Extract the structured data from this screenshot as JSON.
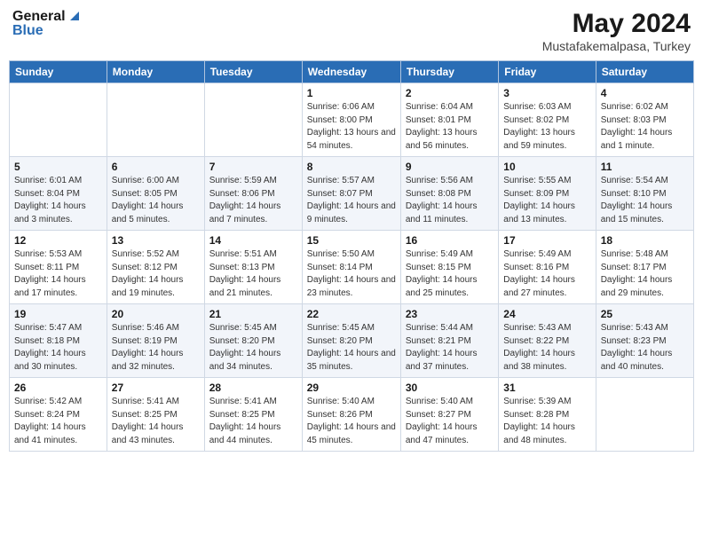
{
  "header": {
    "logo_general": "General",
    "logo_blue": "Blue",
    "month": "May 2024",
    "location": "Mustafakemalpasa, Turkey"
  },
  "days_of_week": [
    "Sunday",
    "Monday",
    "Tuesday",
    "Wednesday",
    "Thursday",
    "Friday",
    "Saturday"
  ],
  "weeks": [
    [
      {
        "day": "",
        "info": ""
      },
      {
        "day": "",
        "info": ""
      },
      {
        "day": "",
        "info": ""
      },
      {
        "day": "1",
        "info": "Sunrise: 6:06 AM\nSunset: 8:00 PM\nDaylight: 13 hours\nand 54 minutes."
      },
      {
        "day": "2",
        "info": "Sunrise: 6:04 AM\nSunset: 8:01 PM\nDaylight: 13 hours\nand 56 minutes."
      },
      {
        "day": "3",
        "info": "Sunrise: 6:03 AM\nSunset: 8:02 PM\nDaylight: 13 hours\nand 59 minutes."
      },
      {
        "day": "4",
        "info": "Sunrise: 6:02 AM\nSunset: 8:03 PM\nDaylight: 14 hours\nand 1 minute."
      }
    ],
    [
      {
        "day": "5",
        "info": "Sunrise: 6:01 AM\nSunset: 8:04 PM\nDaylight: 14 hours\nand 3 minutes."
      },
      {
        "day": "6",
        "info": "Sunrise: 6:00 AM\nSunset: 8:05 PM\nDaylight: 14 hours\nand 5 minutes."
      },
      {
        "day": "7",
        "info": "Sunrise: 5:59 AM\nSunset: 8:06 PM\nDaylight: 14 hours\nand 7 minutes."
      },
      {
        "day": "8",
        "info": "Sunrise: 5:57 AM\nSunset: 8:07 PM\nDaylight: 14 hours\nand 9 minutes."
      },
      {
        "day": "9",
        "info": "Sunrise: 5:56 AM\nSunset: 8:08 PM\nDaylight: 14 hours\nand 11 minutes."
      },
      {
        "day": "10",
        "info": "Sunrise: 5:55 AM\nSunset: 8:09 PM\nDaylight: 14 hours\nand 13 minutes."
      },
      {
        "day": "11",
        "info": "Sunrise: 5:54 AM\nSunset: 8:10 PM\nDaylight: 14 hours\nand 15 minutes."
      }
    ],
    [
      {
        "day": "12",
        "info": "Sunrise: 5:53 AM\nSunset: 8:11 PM\nDaylight: 14 hours\nand 17 minutes."
      },
      {
        "day": "13",
        "info": "Sunrise: 5:52 AM\nSunset: 8:12 PM\nDaylight: 14 hours\nand 19 minutes."
      },
      {
        "day": "14",
        "info": "Sunrise: 5:51 AM\nSunset: 8:13 PM\nDaylight: 14 hours\nand 21 minutes."
      },
      {
        "day": "15",
        "info": "Sunrise: 5:50 AM\nSunset: 8:14 PM\nDaylight: 14 hours\nand 23 minutes."
      },
      {
        "day": "16",
        "info": "Sunrise: 5:49 AM\nSunset: 8:15 PM\nDaylight: 14 hours\nand 25 minutes."
      },
      {
        "day": "17",
        "info": "Sunrise: 5:49 AM\nSunset: 8:16 PM\nDaylight: 14 hours\nand 27 minutes."
      },
      {
        "day": "18",
        "info": "Sunrise: 5:48 AM\nSunset: 8:17 PM\nDaylight: 14 hours\nand 29 minutes."
      }
    ],
    [
      {
        "day": "19",
        "info": "Sunrise: 5:47 AM\nSunset: 8:18 PM\nDaylight: 14 hours\nand 30 minutes."
      },
      {
        "day": "20",
        "info": "Sunrise: 5:46 AM\nSunset: 8:19 PM\nDaylight: 14 hours\nand 32 minutes."
      },
      {
        "day": "21",
        "info": "Sunrise: 5:45 AM\nSunset: 8:20 PM\nDaylight: 14 hours\nand 34 minutes."
      },
      {
        "day": "22",
        "info": "Sunrise: 5:45 AM\nSunset: 8:20 PM\nDaylight: 14 hours\nand 35 minutes."
      },
      {
        "day": "23",
        "info": "Sunrise: 5:44 AM\nSunset: 8:21 PM\nDaylight: 14 hours\nand 37 minutes."
      },
      {
        "day": "24",
        "info": "Sunrise: 5:43 AM\nSunset: 8:22 PM\nDaylight: 14 hours\nand 38 minutes."
      },
      {
        "day": "25",
        "info": "Sunrise: 5:43 AM\nSunset: 8:23 PM\nDaylight: 14 hours\nand 40 minutes."
      }
    ],
    [
      {
        "day": "26",
        "info": "Sunrise: 5:42 AM\nSunset: 8:24 PM\nDaylight: 14 hours\nand 41 minutes."
      },
      {
        "day": "27",
        "info": "Sunrise: 5:41 AM\nSunset: 8:25 PM\nDaylight: 14 hours\nand 43 minutes."
      },
      {
        "day": "28",
        "info": "Sunrise: 5:41 AM\nSunset: 8:25 PM\nDaylight: 14 hours\nand 44 minutes."
      },
      {
        "day": "29",
        "info": "Sunrise: 5:40 AM\nSunset: 8:26 PM\nDaylight: 14 hours\nand 45 minutes."
      },
      {
        "day": "30",
        "info": "Sunrise: 5:40 AM\nSunset: 8:27 PM\nDaylight: 14 hours\nand 47 minutes."
      },
      {
        "day": "31",
        "info": "Sunrise: 5:39 AM\nSunset: 8:28 PM\nDaylight: 14 hours\nand 48 minutes."
      },
      {
        "day": "",
        "info": ""
      }
    ]
  ]
}
